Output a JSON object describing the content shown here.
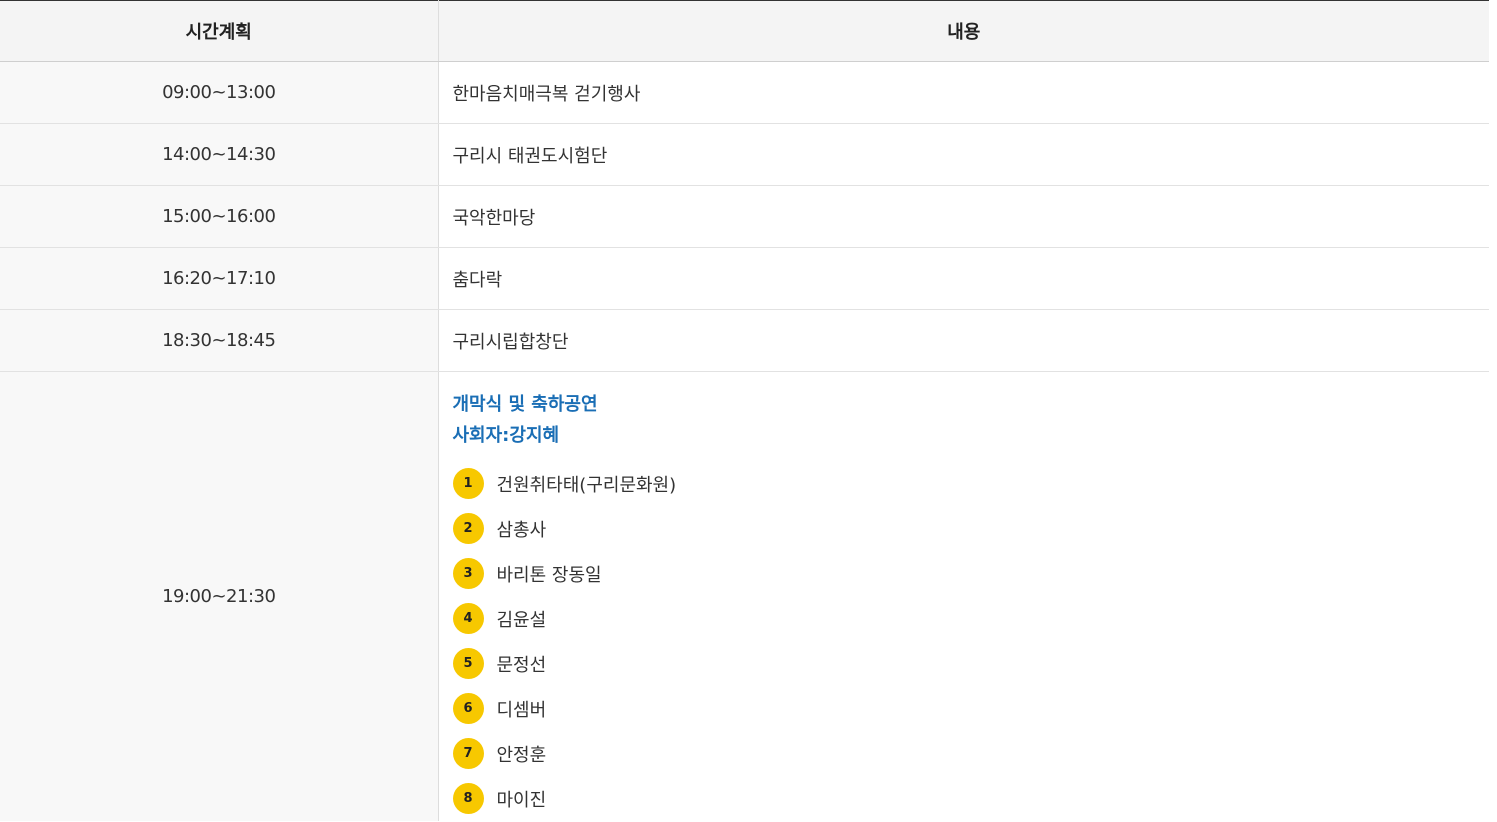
{
  "table": {
    "headers": {
      "time": "시간계획",
      "content": "내용"
    },
    "rows": [
      {
        "time": "09:00~13:00",
        "content": "한마음치매극복 걷기행사"
      },
      {
        "time": "14:00~14:30",
        "content": "구리시 태권도시험단"
      },
      {
        "time": "15:00~16:00",
        "content": "국악한마당"
      },
      {
        "time": "16:20~17:10",
        "content": "춤다락"
      },
      {
        "time": "18:30~18:45",
        "content": "구리시립합창단"
      }
    ],
    "last_row": {
      "time": "19:00~21:30",
      "title": "개막식 및 축하공연",
      "host": "사회자:강지혜",
      "performers": [
        {
          "num": "1",
          "name": "건원취타태(구리문화원)"
        },
        {
          "num": "2",
          "name": "삼총사"
        },
        {
          "num": "3",
          "name": "바리톤 장동일"
        },
        {
          "num": "4",
          "name": "김윤설"
        },
        {
          "num": "5",
          "name": "문정선"
        },
        {
          "num": "6",
          "name": "디셈버"
        },
        {
          "num": "7",
          "name": "안정훈"
        },
        {
          "num": "8",
          "name": "마이진"
        }
      ]
    }
  },
  "colors": {
    "accent_blue": "#1a6eb5",
    "badge_yellow": "#f7c800"
  }
}
